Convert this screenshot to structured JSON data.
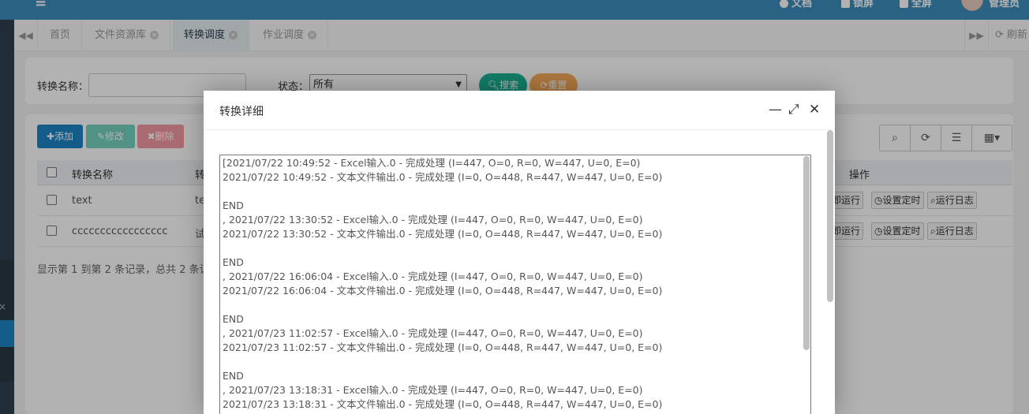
{
  "header": {
    "items": [
      {
        "label": "文档",
        "icon": "question-icon"
      },
      {
        "label": "锁屏",
        "icon": "lock-icon"
      },
      {
        "label": "全屏",
        "icon": "expand-icon"
      },
      {
        "label": "管理员",
        "icon": "avatar"
      }
    ]
  },
  "tabs": [
    {
      "label": "首页",
      "closable": false
    },
    {
      "label": "文件资源库",
      "closable": true
    },
    {
      "label": "转换调度",
      "closable": true,
      "active": true
    },
    {
      "label": "作业调度",
      "closable": true
    }
  ],
  "tabbar": {
    "refresh_label": "刷新"
  },
  "search": {
    "name_label": "转换名称：",
    "status_label": "状态：",
    "status_selected": "所有",
    "search_button": "搜索",
    "reset_button": "重置"
  },
  "toolbar": {
    "add": "添加",
    "edit": "修改",
    "delete": "删除"
  },
  "table": {
    "headers": [
      "转换名称",
      "转",
      "操作"
    ],
    "rows": [
      {
        "name": "text",
        "col2": "te",
        "actions": [
          "即运行",
          "设置定时",
          "运行日志"
        ]
      },
      {
        "name": "ccccccccccccccccc",
        "col2": "试",
        "actions": [
          "即运行",
          "设置定时",
          "运行日志"
        ]
      }
    ],
    "footer": "显示第 1 到第 2 条记录，总共 2 条记"
  },
  "modal": {
    "title": "转换详细",
    "log_lines": [
      "[2021/07/22 10:49:52 - Excel输入.0 - 完成处理 (I=447, O=0, R=0, W=447, U=0, E=0)",
      "2021/07/22 10:49:52 - 文本文件输出.0 - 完成处理 (I=0, O=448, R=447, W=447, U=0, E=0)",
      "",
      "END",
      ", 2021/07/22 13:30:52 - Excel输入.0 - 完成处理 (I=447, O=0, R=0, W=447, U=0, E=0)",
      "2021/07/22 13:30:52 - 文本文件输出.0 - 完成处理 (I=0, O=448, R=447, W=447, U=0, E=0)",
      "",
      "END",
      ", 2021/07/22 16:06:04 - Excel输入.0 - 完成处理 (I=447, O=0, R=0, W=447, U=0, E=0)",
      "2021/07/22 16:06:04 - 文本文件输出.0 - 完成处理 (I=0, O=448, R=447, W=447, U=0, E=0)",
      "",
      "END",
      ", 2021/07/23 11:02:57 - Excel输入.0 - 完成处理 (I=447, O=0, R=0, W=447, U=0, E=0)",
      "2021/07/23 11:02:57 - 文本文件输出.0 - 完成处理 (I=0, O=448, R=447, W=447, U=0, E=0)",
      "",
      "END",
      ", 2021/07/23 13:18:31 - Excel输入.0 - 完成处理 (I=447, O=0, R=0, W=447, U=0, E=0)",
      "2021/07/23 13:18:31 - 文本文件输出.0 - 完成处理 (I=0, O=448, R=447, W=447, U=0, E=0)"
    ]
  }
}
